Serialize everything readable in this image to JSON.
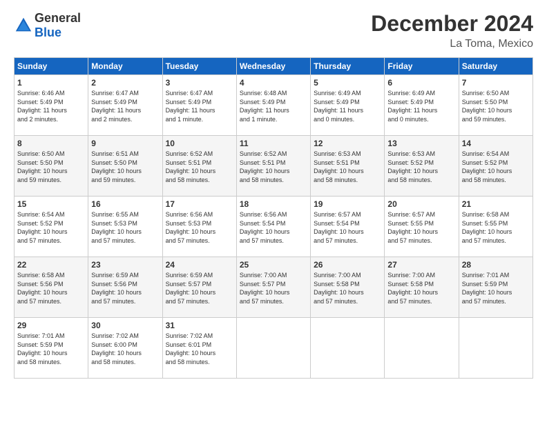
{
  "logo": {
    "general": "General",
    "blue": "Blue"
  },
  "header": {
    "month": "December 2024",
    "location": "La Toma, Mexico"
  },
  "days_of_week": [
    "Sunday",
    "Monday",
    "Tuesday",
    "Wednesday",
    "Thursday",
    "Friday",
    "Saturday"
  ],
  "weeks": [
    [
      {
        "day": "1",
        "info": "Sunrise: 6:46 AM\nSunset: 5:49 PM\nDaylight: 11 hours\nand 2 minutes."
      },
      {
        "day": "2",
        "info": "Sunrise: 6:47 AM\nSunset: 5:49 PM\nDaylight: 11 hours\nand 2 minutes."
      },
      {
        "day": "3",
        "info": "Sunrise: 6:47 AM\nSunset: 5:49 PM\nDaylight: 11 hours\nand 1 minute."
      },
      {
        "day": "4",
        "info": "Sunrise: 6:48 AM\nSunset: 5:49 PM\nDaylight: 11 hours\nand 1 minute."
      },
      {
        "day": "5",
        "info": "Sunrise: 6:49 AM\nSunset: 5:49 PM\nDaylight: 11 hours\nand 0 minutes."
      },
      {
        "day": "6",
        "info": "Sunrise: 6:49 AM\nSunset: 5:49 PM\nDaylight: 11 hours\nand 0 minutes."
      },
      {
        "day": "7",
        "info": "Sunrise: 6:50 AM\nSunset: 5:50 PM\nDaylight: 10 hours\nand 59 minutes."
      }
    ],
    [
      {
        "day": "8",
        "info": "Sunrise: 6:50 AM\nSunset: 5:50 PM\nDaylight: 10 hours\nand 59 minutes."
      },
      {
        "day": "9",
        "info": "Sunrise: 6:51 AM\nSunset: 5:50 PM\nDaylight: 10 hours\nand 59 minutes."
      },
      {
        "day": "10",
        "info": "Sunrise: 6:52 AM\nSunset: 5:51 PM\nDaylight: 10 hours\nand 58 minutes."
      },
      {
        "day": "11",
        "info": "Sunrise: 6:52 AM\nSunset: 5:51 PM\nDaylight: 10 hours\nand 58 minutes."
      },
      {
        "day": "12",
        "info": "Sunrise: 6:53 AM\nSunset: 5:51 PM\nDaylight: 10 hours\nand 58 minutes."
      },
      {
        "day": "13",
        "info": "Sunrise: 6:53 AM\nSunset: 5:52 PM\nDaylight: 10 hours\nand 58 minutes."
      },
      {
        "day": "14",
        "info": "Sunrise: 6:54 AM\nSunset: 5:52 PM\nDaylight: 10 hours\nand 58 minutes."
      }
    ],
    [
      {
        "day": "15",
        "info": "Sunrise: 6:54 AM\nSunset: 5:52 PM\nDaylight: 10 hours\nand 57 minutes."
      },
      {
        "day": "16",
        "info": "Sunrise: 6:55 AM\nSunset: 5:53 PM\nDaylight: 10 hours\nand 57 minutes."
      },
      {
        "day": "17",
        "info": "Sunrise: 6:56 AM\nSunset: 5:53 PM\nDaylight: 10 hours\nand 57 minutes."
      },
      {
        "day": "18",
        "info": "Sunrise: 6:56 AM\nSunset: 5:54 PM\nDaylight: 10 hours\nand 57 minutes."
      },
      {
        "day": "19",
        "info": "Sunrise: 6:57 AM\nSunset: 5:54 PM\nDaylight: 10 hours\nand 57 minutes."
      },
      {
        "day": "20",
        "info": "Sunrise: 6:57 AM\nSunset: 5:55 PM\nDaylight: 10 hours\nand 57 minutes."
      },
      {
        "day": "21",
        "info": "Sunrise: 6:58 AM\nSunset: 5:55 PM\nDaylight: 10 hours\nand 57 minutes."
      }
    ],
    [
      {
        "day": "22",
        "info": "Sunrise: 6:58 AM\nSunset: 5:56 PM\nDaylight: 10 hours\nand 57 minutes."
      },
      {
        "day": "23",
        "info": "Sunrise: 6:59 AM\nSunset: 5:56 PM\nDaylight: 10 hours\nand 57 minutes."
      },
      {
        "day": "24",
        "info": "Sunrise: 6:59 AM\nSunset: 5:57 PM\nDaylight: 10 hours\nand 57 minutes."
      },
      {
        "day": "25",
        "info": "Sunrise: 7:00 AM\nSunset: 5:57 PM\nDaylight: 10 hours\nand 57 minutes."
      },
      {
        "day": "26",
        "info": "Sunrise: 7:00 AM\nSunset: 5:58 PM\nDaylight: 10 hours\nand 57 minutes."
      },
      {
        "day": "27",
        "info": "Sunrise: 7:00 AM\nSunset: 5:58 PM\nDaylight: 10 hours\nand 57 minutes."
      },
      {
        "day": "28",
        "info": "Sunrise: 7:01 AM\nSunset: 5:59 PM\nDaylight: 10 hours\nand 57 minutes."
      }
    ],
    [
      {
        "day": "29",
        "info": "Sunrise: 7:01 AM\nSunset: 5:59 PM\nDaylight: 10 hours\nand 58 minutes."
      },
      {
        "day": "30",
        "info": "Sunrise: 7:02 AM\nSunset: 6:00 PM\nDaylight: 10 hours\nand 58 minutes."
      },
      {
        "day": "31",
        "info": "Sunrise: 7:02 AM\nSunset: 6:01 PM\nDaylight: 10 hours\nand 58 minutes."
      },
      {
        "day": "",
        "info": ""
      },
      {
        "day": "",
        "info": ""
      },
      {
        "day": "",
        "info": ""
      },
      {
        "day": "",
        "info": ""
      }
    ]
  ]
}
